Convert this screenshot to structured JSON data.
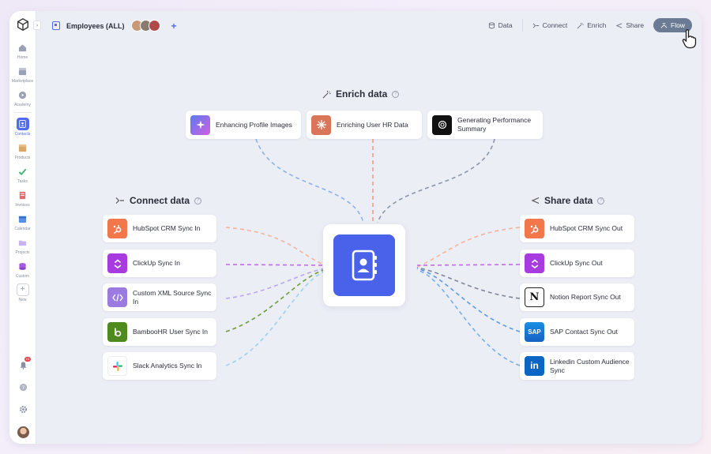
{
  "topbar": {
    "table_name": "Employees (ALL)",
    "add_label": "+",
    "actions": {
      "data": "Data",
      "connect": "Connect",
      "enrich": "Enrich",
      "share": "Share",
      "flow": "Flow"
    }
  },
  "sidebar": {
    "items": [
      {
        "label": "Home",
        "icon": "home-icon"
      },
      {
        "label": "Marketplace",
        "icon": "store-icon"
      },
      {
        "label": "Academy",
        "icon": "play-icon"
      },
      {
        "label": "Contacts",
        "icon": "contacts-icon",
        "active": true
      },
      {
        "label": "Products",
        "icon": "box-icon"
      },
      {
        "label": "Tasks",
        "icon": "check-icon"
      },
      {
        "label": "Invoices",
        "icon": "invoice-icon"
      },
      {
        "label": "Calendar",
        "icon": "calendar-icon"
      },
      {
        "label": "Projects",
        "icon": "folder-icon"
      },
      {
        "label": "Custom",
        "icon": "database-icon"
      },
      {
        "label": "New",
        "icon": "plus-icon"
      }
    ],
    "notification_badge": "10"
  },
  "enrich": {
    "title": "Enrich data",
    "cards": [
      {
        "label": "Enhancing Profile Images"
      },
      {
        "label": "Enriching User HR Data"
      },
      {
        "label": "Generating Performance Summary"
      }
    ]
  },
  "connect": {
    "title": "Connect data",
    "cards": [
      {
        "label": "HubSpot CRM Sync In"
      },
      {
        "label": "ClickUp Sync In"
      },
      {
        "label": "Custom XML Source Sync In"
      },
      {
        "label": "BambooHR User Sync In"
      },
      {
        "label": "Slack Analytics Sync In"
      }
    ]
  },
  "share": {
    "title": "Share data",
    "cards": [
      {
        "label": "HubSpot CRM Sync Out"
      },
      {
        "label": "ClickUp Sync Out"
      },
      {
        "label": "Notion Report Sync Out"
      },
      {
        "label": "SAP Contact Sync Out"
      },
      {
        "label": "Linkedin Custom Audience Sync"
      }
    ]
  },
  "colors": {
    "accent": "#4f6bf2",
    "hubspot": "#f2784b",
    "clickup": "#a83be0",
    "xml": "#9b7be0",
    "bamboo": "#4f8a1f",
    "sap": "#1f6fd1",
    "linkedin": "#0a66c2"
  }
}
